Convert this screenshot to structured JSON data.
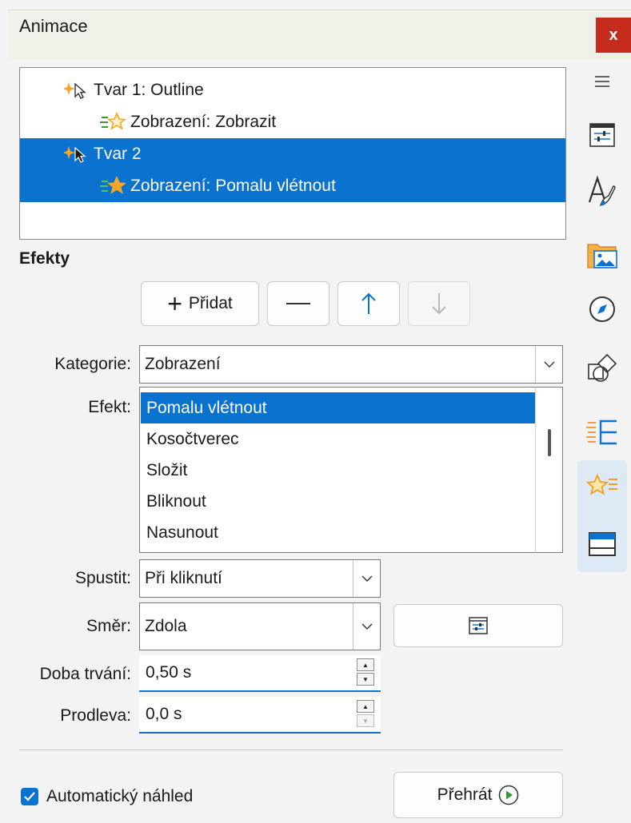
{
  "panel": {
    "title": "Animace",
    "close_label": "x"
  },
  "animation_list": [
    {
      "label": "Tvar 1: Outline",
      "indent": 1,
      "icon": "pointer-sparkle-icon",
      "selected": false
    },
    {
      "label": "Zobrazení: Zobrazit",
      "indent": 2,
      "icon": "star-entrance-icon",
      "selected": false
    },
    {
      "label": "Tvar 2",
      "indent": 1,
      "icon": "pointer-sparkle-icon",
      "selected": true
    },
    {
      "label": "Zobrazení: Pomalu vlétnout",
      "indent": 2,
      "icon": "star-entrance-icon",
      "selected": true
    }
  ],
  "effects_section": {
    "label": "Efekty"
  },
  "toolbar": {
    "add_label": "Přidat",
    "remove_icon": "minus-icon",
    "move_up_icon": "arrow-up-icon",
    "move_down_icon": "arrow-down-icon"
  },
  "form": {
    "category_label": "Kategorie:",
    "category_value": "Zobrazení",
    "effect_label": "Efekt:",
    "effects": [
      "Pomalu vlétnout",
      "Kosočtverec",
      "Složit",
      "Bliknout",
      "Nasunout"
    ],
    "selected_effect_index": 0,
    "start_label": "Spustit:",
    "start_value": "Při kliknutí",
    "direction_label": "Směr:",
    "direction_value": "Zdola",
    "duration_label": "Doba trvání:",
    "duration_value": "0,50 s",
    "delay_label": "Prodleva:",
    "delay_value": "0,0 s"
  },
  "footer": {
    "auto_preview_label": "Automatický náhled",
    "auto_preview_checked": true,
    "play_label": "Přehrát"
  },
  "sidebar": [
    "hamburger-menu-icon",
    "properties-icon",
    "styles-icon",
    "gallery-icon",
    "navigator-icon",
    "shapes-icon",
    "slide-transition-icon",
    "animation-icon",
    "master-slides-icon"
  ],
  "colors": {
    "accent": "#0a72cf",
    "close": "#c42b1c",
    "star": "#f5a623"
  }
}
